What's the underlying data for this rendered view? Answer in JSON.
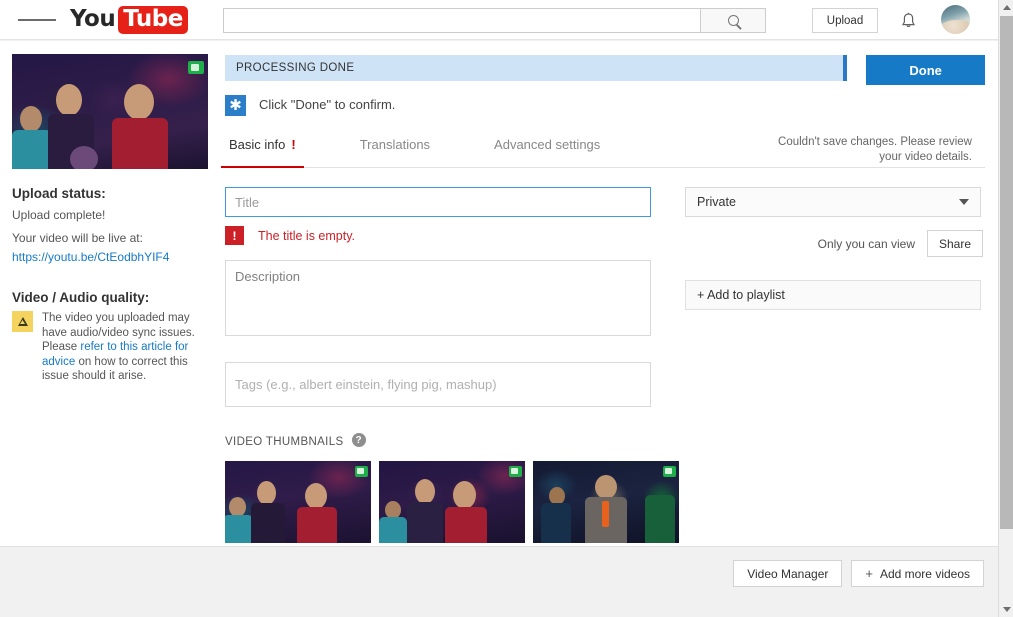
{
  "masthead": {
    "guide_icon": "hamburger-menu-icon",
    "logo_you": "You",
    "logo_tube": "Tube",
    "search": {
      "value": "",
      "placeholder": ""
    },
    "search_icon": "search-icon",
    "upload_label": "Upload",
    "bell_icon": "notifications-bell-icon",
    "avatar": "account-avatar"
  },
  "sidebar": {
    "upload_status_heading": "Upload status:",
    "upload_status_text": "Upload complete!",
    "live_at_text": "Your video will be live at:",
    "video_url": "https://youtu.be/CtEodbhYIF4",
    "quality_heading": "Video / Audio quality:",
    "quality_text_before": "The video you uploaded may have audio/video sync issues. Please ",
    "quality_link": "refer to this article for advice",
    "quality_text_after": " on how to correct this issue should it arise."
  },
  "main": {
    "banner_label": "PROCESSING DONE",
    "done_label": "Done",
    "confirm_text": "Click \"Done\" to confirm.",
    "save_error": "Couldn't save changes. Please review your video details.",
    "tabs": [
      {
        "label": "Basic info",
        "active": true,
        "warn": "!"
      },
      {
        "label": "Translations",
        "active": false,
        "warn": ""
      },
      {
        "label": "Advanced settings",
        "active": false,
        "warn": ""
      }
    ],
    "title_field": {
      "value": "",
      "placeholder": "Title"
    },
    "title_error_badge": "!",
    "title_error": "The title is empty.",
    "description_field": {
      "value": "",
      "placeholder": "Description"
    },
    "tags_field": {
      "value": "",
      "placeholder": "Tags (e.g., albert einstein, flying pig, mashup)"
    },
    "privacy_value": "Private",
    "privacy_caret": "chevron-down-icon",
    "share_note": "Only you can view",
    "share_label": "Share",
    "playlist_label": "+ Add to playlist",
    "thumbnails_label": "VIDEO THUMBNAILS",
    "thumbnails_help": "?",
    "thumbnails": [
      {
        "alt": "audience-frame-1"
      },
      {
        "alt": "audience-frame-2"
      },
      {
        "alt": "host-frame-3"
      }
    ]
  },
  "footer": {
    "video_manager_label": "Video Manager",
    "add_more_plus": "+",
    "add_more_label": "Add more videos"
  },
  "colors": {
    "brand_red": "#e62117",
    "accent_blue": "#167ac6",
    "banner_blue": "#cfe3f7",
    "error_red": "#cc2027",
    "warn_yellow": "#f4d35e",
    "link_blue": "#167ac6"
  }
}
